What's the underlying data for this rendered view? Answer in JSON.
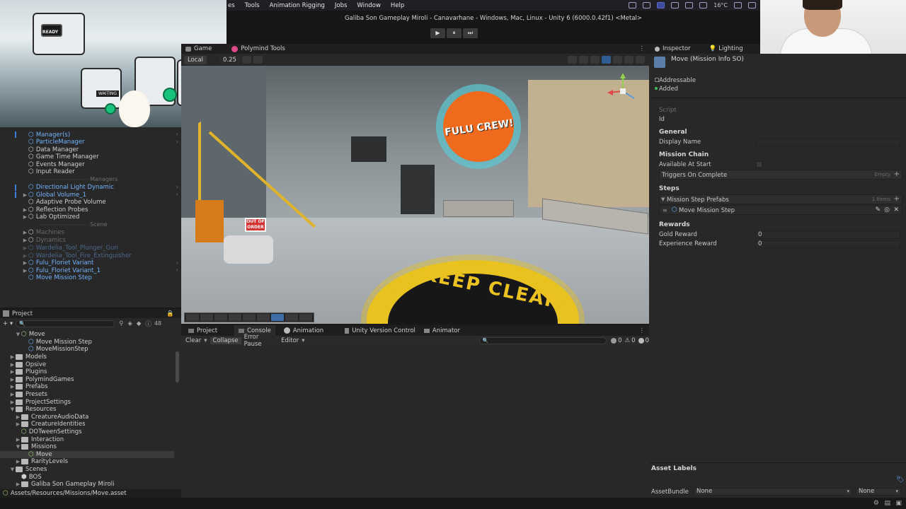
{
  "menu": {
    "items": [
      "es",
      "Tools",
      "Animation Rigging",
      "Jobs",
      "Window",
      "Help"
    ],
    "temperature": "16°C"
  },
  "titlebar": {
    "title": "Galiba Son Gameplay Miroli - Canavarhane - Windows, Mac, Linux - Unity 6 (6000.0.42f1) <Metal>",
    "play": "▶",
    "pause": "⏸",
    "step": "⏭"
  },
  "gamecam": {
    "ready_label": "READY",
    "waiting_label": "WAITING"
  },
  "scene": {
    "tabs": [
      "Game",
      "Polymind Tools"
    ],
    "local_label": "Local",
    "snap_value": "0.25",
    "graffiti_text": "FULU CREW!",
    "sign_text": "OUT OF ORDER",
    "floor_text": "KEEP CLEAR"
  },
  "hierarchy": {
    "items": [
      {
        "label": "Manager(s)",
        "style": "blue",
        "indent": 40,
        "icon": "prefab"
      },
      {
        "label": "ParticleManager",
        "style": "blue",
        "indent": 40,
        "icon": "prefab"
      },
      {
        "label": "Data Manager",
        "style": "gray",
        "indent": 40,
        "icon": "go"
      },
      {
        "label": "Game Time Manager",
        "style": "gray",
        "indent": 40,
        "icon": "go"
      },
      {
        "label": "Events Manager",
        "style": "gray",
        "indent": 40,
        "icon": "go"
      },
      {
        "label": "Input Reader",
        "style": "gray",
        "indent": 40,
        "icon": "go"
      },
      {
        "label": "Directional Light Dynamic",
        "style": "blue",
        "indent": 40,
        "icon": "prefab"
      },
      {
        "label": "Global Volume_1",
        "style": "blue",
        "indent": 40,
        "icon": "prefab"
      },
      {
        "label": "Adaptive Probe Volume",
        "style": "gray",
        "indent": 40,
        "icon": "go"
      },
      {
        "label": "Reflection Probes",
        "style": "gray",
        "indent": 40,
        "icon": "go"
      },
      {
        "label": "Lab Optimized",
        "style": "gray",
        "indent": 40,
        "icon": "go"
      },
      {
        "label": "Machines",
        "style": "dim",
        "indent": 40,
        "icon": "go"
      },
      {
        "label": "Dynamics",
        "style": "dim",
        "indent": 40,
        "icon": "go"
      },
      {
        "label": "Wardelia_Tool_Plunger_Gun",
        "style": "blue-dim",
        "indent": 40,
        "icon": "prefab"
      },
      {
        "label": "Wardelia_Tool_Fire_Extinguisher",
        "style": "blue-dim",
        "indent": 40,
        "icon": "prefab"
      },
      {
        "label": "Fulu_Floriet Variant",
        "style": "blue",
        "indent": 40,
        "icon": "prefab"
      },
      {
        "label": "Fulu_Floriet Variant_1",
        "style": "blue",
        "indent": 40,
        "icon": "prefab"
      },
      {
        "label": "Move Mission Step",
        "style": "blue",
        "indent": 40,
        "icon": "prefab"
      }
    ],
    "separators": [
      "Managers",
      "Scene"
    ]
  },
  "project": {
    "tab": "Project",
    "asset_count": "48",
    "tree": [
      {
        "label": "Move",
        "indent": 30,
        "kind": "so",
        "arrow": "▼"
      },
      {
        "label": "Move Mission Step",
        "indent": 40,
        "kind": "prefab",
        "arrow": ""
      },
      {
        "label": "MoveMissionStep",
        "indent": 40,
        "kind": "prefab",
        "arrow": ""
      },
      {
        "label": "Models",
        "indent": 22,
        "kind": "folder",
        "arrow": "▶"
      },
      {
        "label": "Opsive",
        "indent": 22,
        "kind": "folder",
        "arrow": "▶"
      },
      {
        "label": "Plugins",
        "indent": 22,
        "kind": "folder",
        "arrow": "▶"
      },
      {
        "label": "PolymindGames",
        "indent": 22,
        "kind": "folder",
        "arrow": "▶"
      },
      {
        "label": "Prefabs",
        "indent": 22,
        "kind": "folder",
        "arrow": "▶"
      },
      {
        "label": "Presets",
        "indent": 22,
        "kind": "folder",
        "arrow": "▶"
      },
      {
        "label": "ProjectSettings",
        "indent": 22,
        "kind": "folder",
        "arrow": "▶"
      },
      {
        "label": "Resources",
        "indent": 22,
        "kind": "folder",
        "arrow": "▼"
      },
      {
        "label": "CreatureAudioData",
        "indent": 30,
        "kind": "folder",
        "arrow": "▶"
      },
      {
        "label": "CreatureIdentities",
        "indent": 30,
        "kind": "folder",
        "arrow": "▶"
      },
      {
        "label": "DOTweenSettings",
        "indent": 30,
        "kind": "so",
        "arrow": ""
      },
      {
        "label": "Interaction",
        "indent": 30,
        "kind": "folder",
        "arrow": "▶"
      },
      {
        "label": "Missions",
        "indent": 30,
        "kind": "folder",
        "arrow": "▼"
      },
      {
        "label": "Move",
        "indent": 40,
        "kind": "so",
        "arrow": "",
        "selected": true
      },
      {
        "label": "RarityLevels",
        "indent": 30,
        "kind": "folder",
        "arrow": "▶"
      },
      {
        "label": "Scenes",
        "indent": 22,
        "kind": "folder",
        "arrow": "▼"
      },
      {
        "label": "BOS",
        "indent": 30,
        "kind": "scene",
        "arrow": ""
      },
      {
        "label": "Galiba Son Gameplay Miroli",
        "indent": 30,
        "kind": "folder",
        "arrow": "▶"
      }
    ],
    "path": "Assets/Resources/Missions/Move.asset"
  },
  "console": {
    "tabs": [
      "Project",
      "Console",
      "Animation",
      "Unity Version Control",
      "Animator"
    ],
    "active_tab": "Console",
    "clear": "Clear",
    "collapse": "Collapse",
    "error_pause": "Error Pause",
    "editor": "Editor",
    "log_count": "0",
    "warn_count": "0",
    "error_count": "0"
  },
  "inspector": {
    "tabs": [
      "Inspector",
      "Lighting"
    ],
    "object_title": "Move (Mission Info SO)",
    "addressable": "Addressable",
    "added": "Added",
    "script_label": "Script",
    "id_label": "Id",
    "general": "General",
    "display_name": "Display Name",
    "mission_chain": "Mission Chain",
    "available_at_start": "Available At Start",
    "triggers_on_complete": "Triggers On Complete",
    "empty": "Empty",
    "steps": "Steps",
    "mission_step_prefabs": "Mission Step Prefabs",
    "items_count": "1 Items",
    "step_item": "Move Mission Step",
    "rewards": "Rewards",
    "gold_reward_label": "Gold Reward",
    "gold_reward": "0",
    "experience_reward_label": "Experience Reward",
    "experience_reward": "0",
    "asset_labels": "Asset Labels",
    "asset_bundle": "AssetBundle",
    "none1": "None",
    "none2": "None"
  },
  "colors": {
    "accent": "#3b7fd9",
    "prefab_blue": "#74b4ff",
    "panel": "#282828"
  }
}
